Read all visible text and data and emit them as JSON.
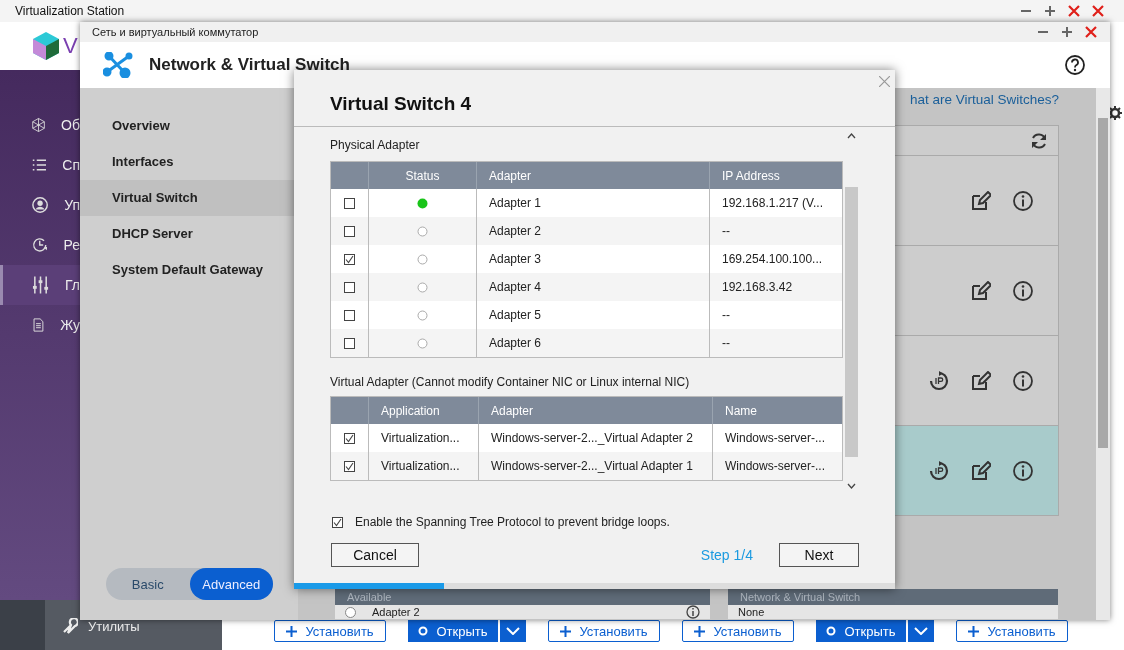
{
  "background_app": {
    "title": "Virtualization Station",
    "logo_letter": "V",
    "sidebar": [
      {
        "label": "Об",
        "selected": false
      },
      {
        "label": "Сп",
        "selected": false
      },
      {
        "label": "Уп",
        "selected": false
      },
      {
        "label": "Ре",
        "selected": false
      },
      {
        "label": "Гл",
        "selected": true
      },
      {
        "label": "Жу",
        "selected": false
      }
    ],
    "utilities_label": "Утилиты",
    "app_buttons": [
      {
        "kind": "install",
        "label": "Установить"
      },
      {
        "kind": "open",
        "label": "Открыть"
      },
      {
        "kind": "install",
        "label": "Установить"
      },
      {
        "kind": "install",
        "label": "Установить"
      },
      {
        "kind": "open",
        "label": "Открыть"
      },
      {
        "kind": "install",
        "label": "Установить"
      }
    ]
  },
  "window": {
    "title": "Сеть и виртуальный коммутатор",
    "heading": "Network & Virtual Switch",
    "nav": [
      {
        "label": "Overview",
        "selected": false
      },
      {
        "label": "Interfaces",
        "selected": false
      },
      {
        "label": "Virtual Switch",
        "selected": true
      },
      {
        "label": "DHCP Server",
        "selected": false
      },
      {
        "label": "System Default Gateway",
        "selected": false
      }
    ],
    "mode_toggle": [
      {
        "label": "Basic",
        "selected": false
      },
      {
        "label": "Advanced",
        "selected": true
      }
    ],
    "help_link": "hat are Virtual Switches?",
    "switch_rows": [
      {
        "ip_reset": false,
        "selected": false
      },
      {
        "ip_reset": false,
        "selected": false
      },
      {
        "ip_reset": true,
        "selected": false
      },
      {
        "ip_reset": true,
        "selected": true
      }
    ],
    "available_table": {
      "header": "Available",
      "rows": [
        {
          "label": "Adapter 2",
          "selected": false
        }
      ]
    },
    "assigned_table": {
      "header": "Network & Virtual Switch",
      "rows": [
        "None"
      ]
    }
  },
  "dialog": {
    "title": "Virtual Switch 4",
    "physical_label": "Physical Adapter",
    "physical_columns": [
      "Status",
      "Adapter",
      "IP Address"
    ],
    "physical_rows": [
      {
        "checked": false,
        "connected": true,
        "adapter": "Adapter 1",
        "ip": "192.168.1.217 (V..."
      },
      {
        "checked": false,
        "connected": false,
        "adapter": "Adapter 2",
        "ip": "--"
      },
      {
        "checked": true,
        "connected": false,
        "adapter": "Adapter 3",
        "ip": "169.254.100.100..."
      },
      {
        "checked": false,
        "connected": false,
        "adapter": "Adapter 4",
        "ip": "192.168.3.42"
      },
      {
        "checked": false,
        "connected": false,
        "adapter": "Adapter 5",
        "ip": "--"
      },
      {
        "checked": false,
        "connected": false,
        "adapter": "Adapter 6",
        "ip": "--"
      }
    ],
    "virtual_label": "Virtual Adapter (Cannot modify Container NIC or Linux internal NIC)",
    "virtual_columns": [
      "Application",
      "Adapter",
      "Name"
    ],
    "virtual_rows": [
      {
        "checked": true,
        "application": "Virtualization...",
        "adapter": "Windows-server-2..._Virtual Adapter 2",
        "name": "Windows-server-..."
      },
      {
        "checked": true,
        "application": "Virtualization...",
        "adapter": "Windows-server-2..._Virtual Adapter 1",
        "name": "Windows-server-..."
      }
    ],
    "stp": {
      "checked": true,
      "label": "Enable the Spanning Tree Protocol to prevent bridge loops."
    },
    "cancel": "Cancel",
    "step": "Step 1/4",
    "next": "Next",
    "progress": {
      "level": 0.25
    }
  }
}
